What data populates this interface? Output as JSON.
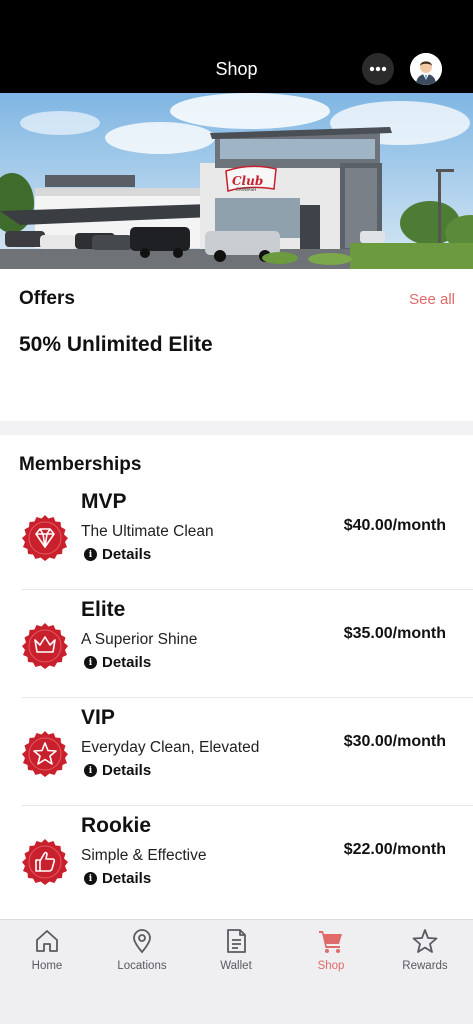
{
  "header": {
    "title": "Shop",
    "more_icon": "more-horizontal-icon",
    "avatar_icon": "user-avatar-icon"
  },
  "hero": {
    "sign_text": "Club",
    "sign_sub": "CARWASH"
  },
  "offers": {
    "title": "Offers",
    "see_all": "See all",
    "items": [
      {
        "name": "50% Unlimited Elite"
      }
    ]
  },
  "memberships": {
    "title": "Memberships",
    "details_label": "Details",
    "items": [
      {
        "name": "MVP",
        "description": "The Ultimate Clean",
        "price": "$40.00/month",
        "icon": "diamond-icon"
      },
      {
        "name": "Elite",
        "description": "A Superior Shine",
        "price": "$35.00/month",
        "icon": "crown-icon"
      },
      {
        "name": "VIP",
        "description": "Everyday Clean, Elevated",
        "price": "$30.00/month",
        "icon": "star-icon"
      },
      {
        "name": "Rookie",
        "description": "Simple & Effective",
        "price": "$22.00/month",
        "icon": "thumbs-up-icon"
      }
    ]
  },
  "tabbar": {
    "items": [
      {
        "label": "Home",
        "icon": "home-icon",
        "active": false
      },
      {
        "label": "Locations",
        "icon": "map-pin-icon",
        "active": false
      },
      {
        "label": "Wallet",
        "icon": "document-icon",
        "active": false
      },
      {
        "label": "Shop",
        "icon": "cart-icon",
        "active": true
      },
      {
        "label": "Rewards",
        "icon": "star-outline-icon",
        "active": false
      }
    ]
  },
  "colors": {
    "accent": "#e06a6a",
    "badge_red": "#c8202c",
    "header_bg": "#000000"
  }
}
